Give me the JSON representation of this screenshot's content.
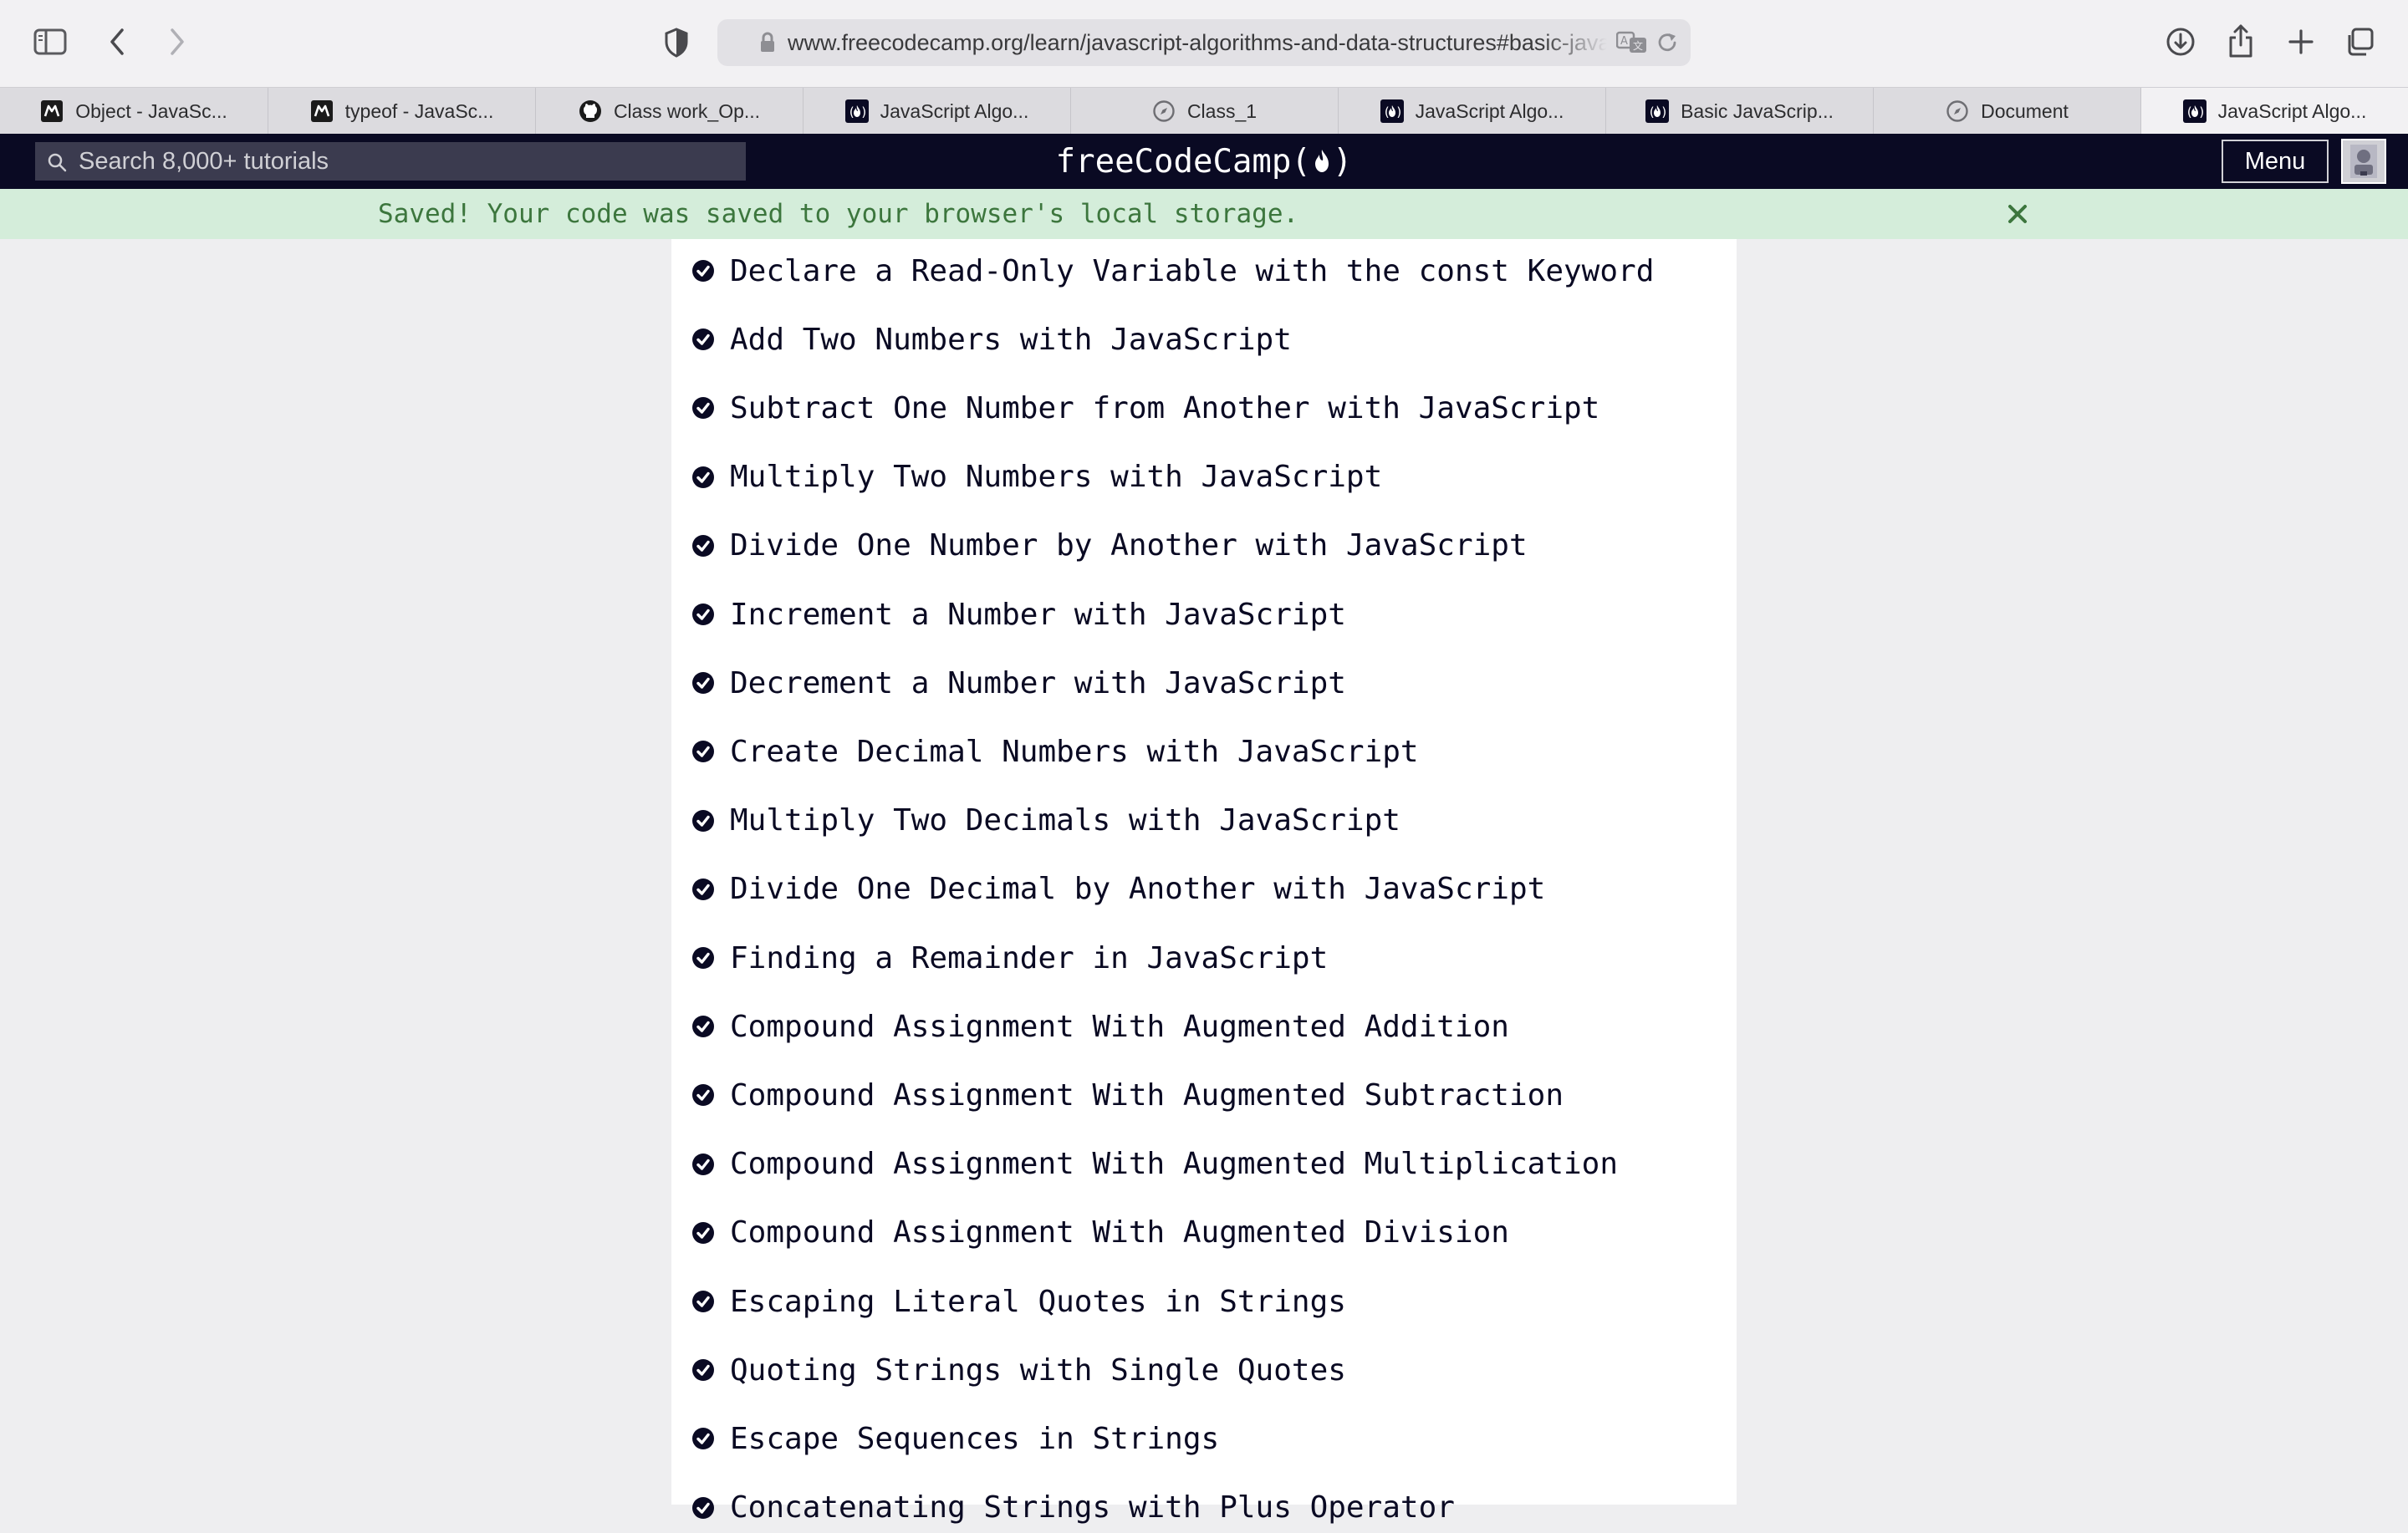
{
  "browser": {
    "url": "www.freecodecamp.org/learn/javascript-algorithms-and-data-structures#basic-javascript",
    "tabs": [
      {
        "label": "Object - JavaSc...",
        "icon": "mdn-icon"
      },
      {
        "label": "typeof - JavaSc...",
        "icon": "mdn-icon"
      },
      {
        "label": "Class work_Op...",
        "icon": "github-icon"
      },
      {
        "label": "JavaScript Algo...",
        "icon": "freecodecamp-icon"
      },
      {
        "label": "Class_1",
        "icon": "compass-icon"
      },
      {
        "label": "JavaScript Algo...",
        "icon": "freecodecamp-icon"
      },
      {
        "label": "Basic JavaScrip...",
        "icon": "freecodecamp-icon"
      },
      {
        "label": "Document",
        "icon": "compass-icon"
      },
      {
        "label": "JavaScript Algo...",
        "icon": "freecodecamp-icon",
        "active": true
      }
    ]
  },
  "nav": {
    "search_placeholder": "Search 8,000+ tutorials",
    "logo_text_left": "freeCodeCamp(",
    "logo_text_right": ")",
    "menu_label": "Menu"
  },
  "flash": {
    "message": "Saved! Your code was saved to your browser's local storage."
  },
  "lessons": [
    "Declare a Read-Only Variable with the const Keyword",
    "Add Two Numbers with JavaScript",
    "Subtract One Number from Another with JavaScript",
    "Multiply Two Numbers with JavaScript",
    "Divide One Number by Another with JavaScript",
    "Increment a Number with JavaScript",
    "Decrement a Number with JavaScript",
    "Create Decimal Numbers with JavaScript",
    "Multiply Two Decimals with JavaScript",
    "Divide One Decimal by Another with JavaScript",
    "Finding a Remainder in JavaScript",
    "Compound Assignment With Augmented Addition",
    "Compound Assignment With Augmented Subtraction",
    "Compound Assignment With Augmented Multiplication",
    "Compound Assignment With Augmented Division",
    "Escaping Literal Quotes in Strings",
    "Quoting Strings with Single Quotes",
    "Escape Sequences in Strings",
    "Concatenating Strings with Plus Operator"
  ],
  "colors": {
    "nav_bg": "#0a0a23",
    "flash_bg": "#d4edda",
    "flash_text": "#3c763d",
    "check": "#0a0a23"
  }
}
